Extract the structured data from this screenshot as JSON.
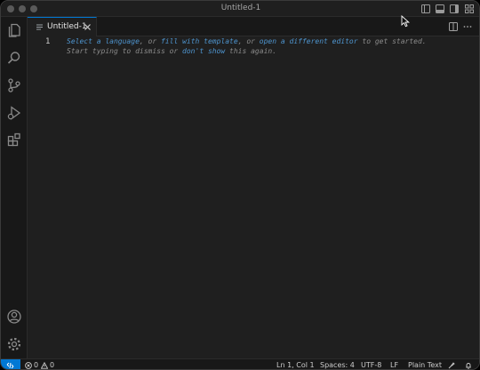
{
  "window": {
    "title": "Untitled-1"
  },
  "tabs": [
    {
      "label": "Untitled-1",
      "active": true
    }
  ],
  "editor": {
    "line_number": "1",
    "hint": {
      "link_select_language": "Select a language",
      "sep1": ", or ",
      "link_fill_template": "fill with template",
      "sep2": ", or ",
      "link_open_editor": "open a different editor",
      "tail1": " to get started.",
      "line2_start": "Start typing to dismiss or ",
      "link_dont_show": "don't show",
      "tail2": " this again."
    }
  },
  "statusbar": {
    "errors": "0",
    "warnings": "0",
    "position": "Ln 1, Col 1",
    "spaces": "Spaces: 4",
    "encoding": "UTF-8",
    "eol": "LF",
    "language": "Plain Text"
  },
  "icons": {
    "activity": [
      "explorer-icon",
      "search-icon",
      "source-control-icon",
      "run-debug-icon",
      "extensions-icon",
      "account-icon",
      "settings-gear-icon"
    ],
    "titlebar": [
      "toggle-primary-sidebar-icon",
      "toggle-panel-icon",
      "toggle-secondary-sidebar-icon",
      "customize-layout-icon"
    ]
  },
  "colors": {
    "accent": "#0078d4",
    "link": "#4e94ce",
    "background": "#1f1f1f",
    "chrome": "#181818"
  }
}
